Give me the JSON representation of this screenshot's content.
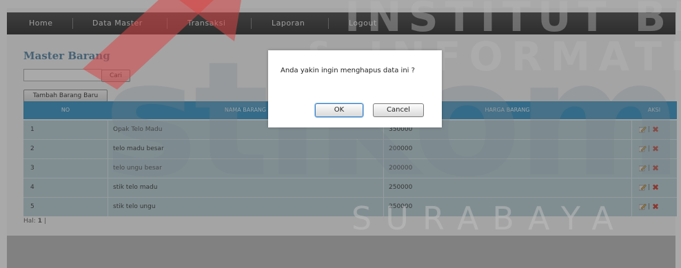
{
  "nav": {
    "items": [
      "Home",
      "Data Master",
      "Transaksi",
      "Laporan",
      "Logout"
    ]
  },
  "page": {
    "title": "Master Barang",
    "search_value": "",
    "search_button": "Cari",
    "add_button": "Tambah Barang Baru"
  },
  "table": {
    "headers": [
      "NO",
      "NAMA BARANG",
      "HARGA BARANG",
      "AKSI"
    ],
    "rows": [
      {
        "no": "1",
        "nama": "Opak Telo Madu",
        "harga": "350000"
      },
      {
        "no": "2",
        "nama": "telo madu besar",
        "harga": "200000"
      },
      {
        "no": "3",
        "nama": "telo ungu besar",
        "harga": "200000"
      },
      {
        "no": "4",
        "nama": "stik telo madu",
        "harga": "250000"
      },
      {
        "no": "5",
        "nama": "stik telo ungu",
        "harga": "250000"
      }
    ],
    "action_separator": "|"
  },
  "pagination": {
    "label": "Hal:",
    "current": "1",
    "separator": "|"
  },
  "dialog": {
    "message": "Anda yakin ingin menghapus data ini ?",
    "ok_label": "OK",
    "cancel_label": "Cancel"
  },
  "watermark": {
    "line1": "INSTITUT BISNIS",
    "line2": "& INFORMATIKA",
    "brand": "stikom",
    "city": "SURABAYA"
  },
  "colors": {
    "nav_bg": "#2a2a2a",
    "title": "#4d7fa0",
    "table_header": "#2b8ec4",
    "row_bg": "#b4ced6",
    "delete_icon": "#cc2e1e"
  }
}
